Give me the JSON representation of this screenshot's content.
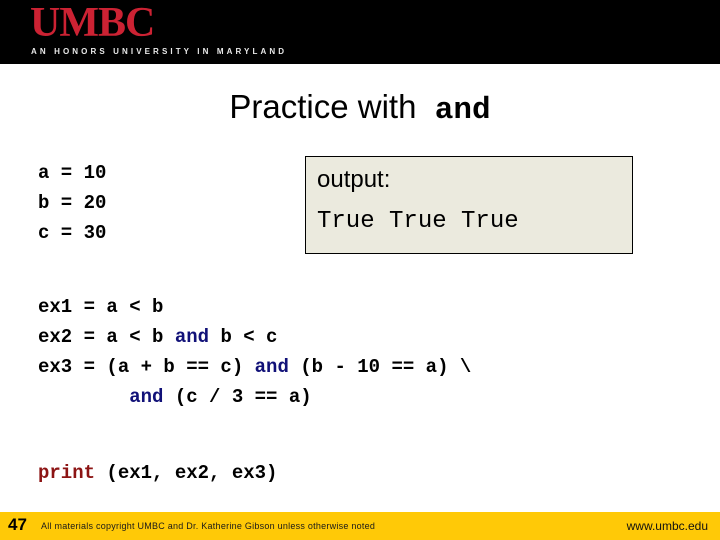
{
  "header": {
    "wordmark": "UMBC",
    "tagline": "AN HONORS UNIVERSITY IN MARYLAND",
    "background_color": "#000000",
    "wordmark_color": "#cc2233"
  },
  "title": {
    "text_plain": "Practice with",
    "text_mono": "and"
  },
  "code": {
    "variables": "a = 10\nb = 20\nc = 30",
    "expressions": {
      "line1_pre": "ex1 = a < b",
      "line2_pre": "ex2 = a < b ",
      "line2_kw": "and",
      "line2_post": " b < c",
      "line3_pre": "ex3 = (a + b == c) ",
      "line3_kw": "and",
      "line3_post": " (b - 10 == a) \\",
      "line4_indent": "        ",
      "line4_kw": "and",
      "line4_post": " (c / 3 == a)"
    },
    "print_statement": {
      "keyword": "print",
      "arguments": " (ex1, ex2, ex3)"
    },
    "keyword_and_color": "#111178",
    "keyword_print_color": "#8c1414"
  },
  "output": {
    "label": "output:",
    "value": "True True True",
    "background_color": "#ebeade",
    "border_color": "#000000"
  },
  "footer": {
    "page_number": "47",
    "copyright": "All materials copyright UMBC and Dr. Katherine Gibson unless otherwise noted",
    "url": "www.umbc.edu",
    "background_color": "#ffc907"
  }
}
